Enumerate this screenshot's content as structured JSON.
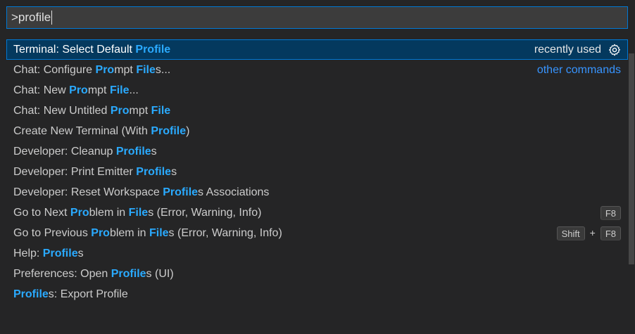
{
  "input": {
    "value": ">profile"
  },
  "labels": {
    "recently_used": "recently used",
    "other_commands": "other commands",
    "plus": "+"
  },
  "items": [
    {
      "segments": [
        {
          "t": "Terminal: Select Default "
        },
        {
          "t": "Profile",
          "h": true
        }
      ]
    },
    {
      "segments": [
        {
          "t": "Chat: Configure "
        },
        {
          "t": "Pro",
          "h": true
        },
        {
          "t": "mpt "
        },
        {
          "t": "File",
          "h": true
        },
        {
          "t": "s..."
        }
      ]
    },
    {
      "segments": [
        {
          "t": "Chat: New "
        },
        {
          "t": "Pro",
          "h": true
        },
        {
          "t": "mpt "
        },
        {
          "t": "File",
          "h": true
        },
        {
          "t": "..."
        }
      ]
    },
    {
      "segments": [
        {
          "t": "Chat: New Untitled "
        },
        {
          "t": "Pro",
          "h": true
        },
        {
          "t": "mpt "
        },
        {
          "t": "File",
          "h": true
        }
      ]
    },
    {
      "segments": [
        {
          "t": "Create New Terminal (With "
        },
        {
          "t": "Profile",
          "h": true
        },
        {
          "t": ")"
        }
      ]
    },
    {
      "segments": [
        {
          "t": "Developer: Cleanup "
        },
        {
          "t": "Profile",
          "h": true
        },
        {
          "t": "s"
        }
      ]
    },
    {
      "segments": [
        {
          "t": "Developer: Print Emitter "
        },
        {
          "t": "Profile",
          "h": true
        },
        {
          "t": "s"
        }
      ]
    },
    {
      "segments": [
        {
          "t": "Developer: Reset Workspace "
        },
        {
          "t": "Profile",
          "h": true
        },
        {
          "t": "s Associations"
        }
      ]
    },
    {
      "segments": [
        {
          "t": "Go to Next "
        },
        {
          "t": "Pro",
          "h": true
        },
        {
          "t": "blem in "
        },
        {
          "t": "File",
          "h": true
        },
        {
          "t": "s (Error, Warning, Info)"
        }
      ],
      "keys": [
        "F8"
      ]
    },
    {
      "segments": [
        {
          "t": "Go to Previous "
        },
        {
          "t": "Pro",
          "h": true
        },
        {
          "t": "blem in "
        },
        {
          "t": "File",
          "h": true
        },
        {
          "t": "s (Error, Warning, Info)"
        }
      ],
      "keys": [
        "Shift",
        "F8"
      ]
    },
    {
      "segments": [
        {
          "t": "Help: "
        },
        {
          "t": "Profile",
          "h": true
        },
        {
          "t": "s"
        }
      ]
    },
    {
      "segments": [
        {
          "t": "Preferences: Open "
        },
        {
          "t": "Profile",
          "h": true
        },
        {
          "t": "s (UI)"
        }
      ]
    },
    {
      "segments": [
        {
          "t": "Profile",
          "h": true
        },
        {
          "t": "s: Export Profile"
        }
      ]
    }
  ],
  "icons": {
    "settings": "gear-icon"
  }
}
